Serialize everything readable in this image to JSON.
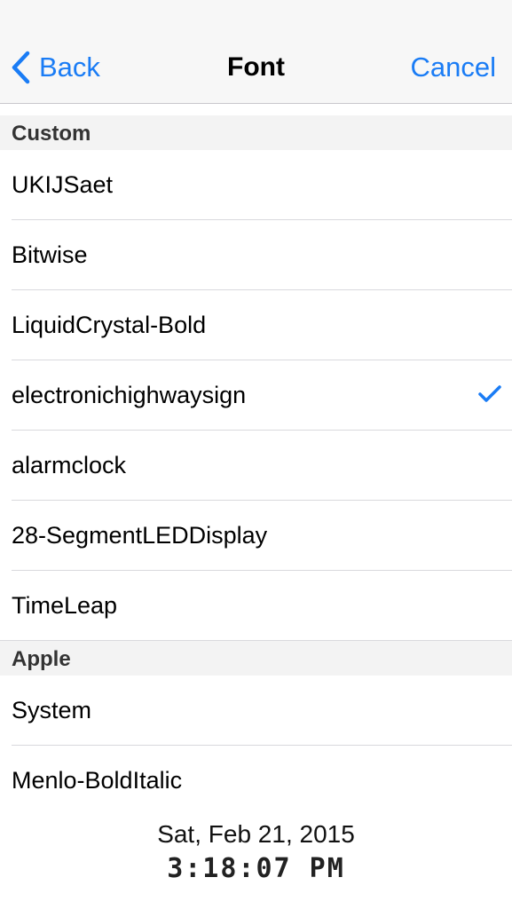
{
  "nav": {
    "back_label": "Back",
    "title": "Font",
    "cancel_label": "Cancel",
    "accent_color": "#1a7cf5"
  },
  "sections": [
    {
      "header": "Custom",
      "items": [
        {
          "label": "UKIJSaet"
        },
        {
          "label": "Bitwise"
        },
        {
          "label": "LiquidCrystal-Bold"
        },
        {
          "label": "electronichighwaysign",
          "selected": true
        },
        {
          "label": "alarmclock"
        },
        {
          "label": "28-SegmentLEDDisplay"
        },
        {
          "label": "TimeLeap"
        }
      ]
    },
    {
      "header": "Apple",
      "items": [
        {
          "label": "System"
        },
        {
          "label": "Menlo-BoldItalic"
        }
      ]
    }
  ],
  "footer": {
    "date": "Sat, Feb 21, 2015",
    "time": "3:18:07 PM"
  }
}
